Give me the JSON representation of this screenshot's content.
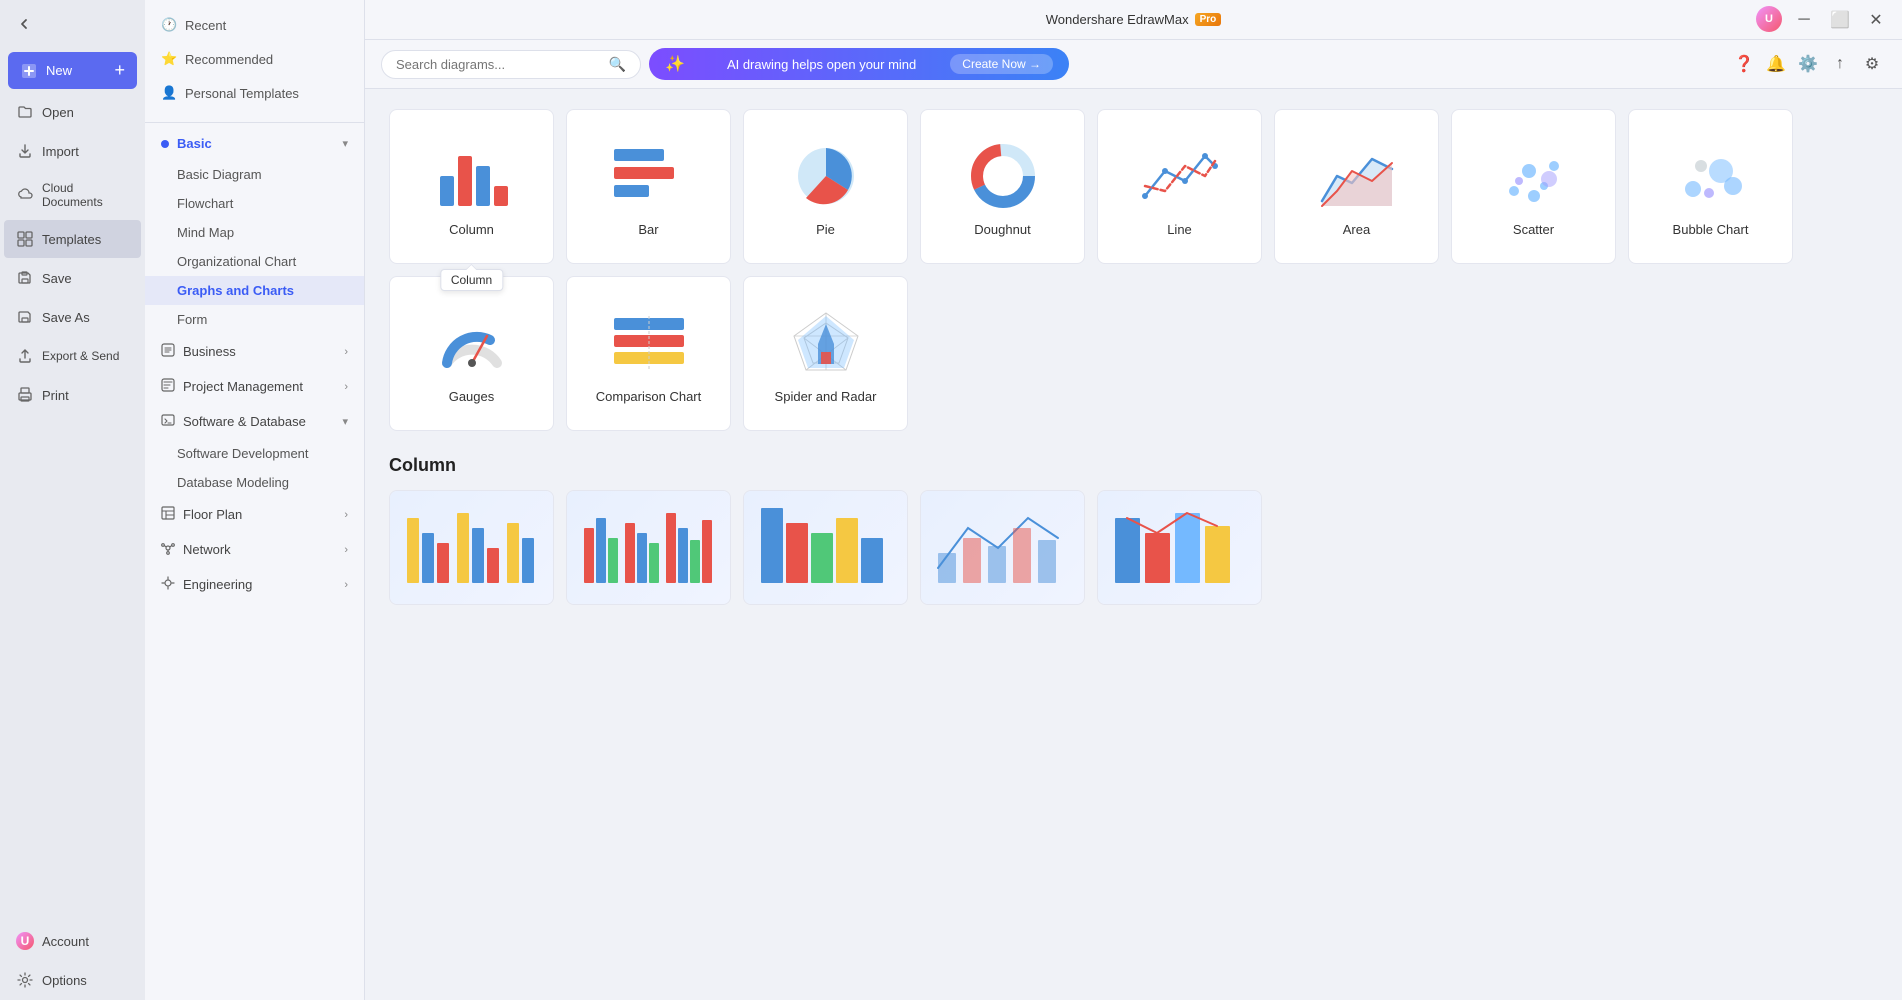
{
  "app": {
    "title": "Wondershare EdrawMax",
    "pro_badge": "Pro"
  },
  "sidebar": {
    "new_label": "New",
    "open_label": "Open",
    "import_label": "Import",
    "cloud_label": "Cloud Documents",
    "templates_label": "Templates",
    "save_label": "Save",
    "save_as_label": "Save As",
    "export_label": "Export & Send",
    "print_label": "Print",
    "account_label": "Account",
    "options_label": "Options"
  },
  "middle_panel": {
    "recent_label": "Recent",
    "recommended_label": "Recommended",
    "personal_label": "Personal Templates",
    "basic_label": "Basic",
    "basic_sub": [
      "Basic Diagram",
      "Flowchart",
      "Mind Map",
      "Organizational Chart",
      "Graphs and Charts",
      "Form"
    ],
    "business_label": "Business",
    "project_label": "Project Management",
    "software_label": "Software & Database",
    "software_sub": [
      "Software Development",
      "Database Modeling"
    ],
    "floor_label": "Floor Plan",
    "network_label": "Network",
    "engineering_label": "Engineering"
  },
  "search": {
    "placeholder": "Search diagrams..."
  },
  "ai_banner": {
    "text": "AI drawing helps open your mind",
    "cta": "Create Now →"
  },
  "charts": [
    {
      "id": "column",
      "label": "Column",
      "type": "column"
    },
    {
      "id": "bar",
      "label": "Bar",
      "type": "bar"
    },
    {
      "id": "pie",
      "label": "Pie",
      "type": "pie"
    },
    {
      "id": "doughnut",
      "label": "Doughnut",
      "type": "doughnut"
    },
    {
      "id": "line",
      "label": "Line",
      "type": "line"
    },
    {
      "id": "area",
      "label": "Area",
      "type": "area"
    },
    {
      "id": "scatter",
      "label": "Scatter",
      "type": "scatter"
    },
    {
      "id": "bubble",
      "label": "Bubble Chart",
      "type": "bubble"
    },
    {
      "id": "gauges",
      "label": "Gauges",
      "type": "gauges"
    },
    {
      "id": "comparison",
      "label": "Comparison Chart",
      "type": "comparison"
    },
    {
      "id": "spider",
      "label": "Spider and Radar",
      "type": "spider"
    }
  ],
  "tooltip": {
    "column": "Column"
  },
  "section": {
    "label": "Column"
  },
  "colors": {
    "blue": "#3b5cf5",
    "red": "#f5576c",
    "orange": "#f5a623",
    "teal": "#4ecdc4",
    "light_blue": "#74b9ff",
    "accent": "#5b6af0"
  }
}
